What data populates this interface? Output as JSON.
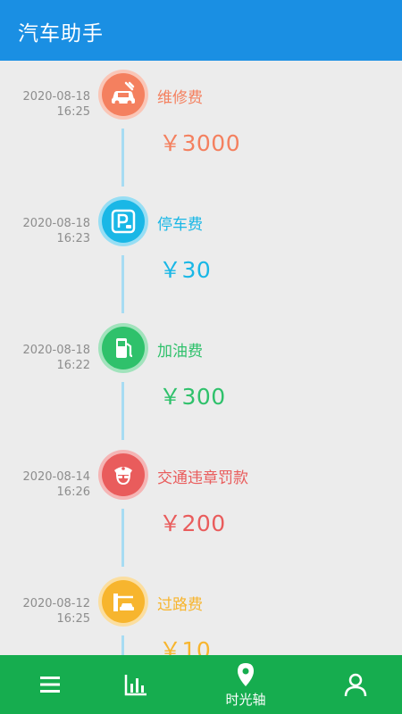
{
  "app": {
    "title": "汽车助手"
  },
  "colors": {
    "appbar": "#1a8fe3",
    "bottom_bar": "#16ad4f",
    "timeline_line": "#a7dcf3",
    "repair": "#f4805f",
    "parking": "#19b7e6",
    "fuel": "#2fc16b",
    "violation": "#e95c5c",
    "toll": "#f7b52e"
  },
  "entries": [
    {
      "date": "2020-08-18",
      "time": "16:25",
      "category": "维修费",
      "amount": "￥3000",
      "icon": "car-repair-icon",
      "color": "#f4805f"
    },
    {
      "date": "2020-08-18",
      "time": "16:23",
      "category": "停车费",
      "amount": "￥30",
      "icon": "parking-icon",
      "color": "#19b7e6"
    },
    {
      "date": "2020-08-18",
      "time": "16:22",
      "category": "加油费",
      "amount": "￥300",
      "icon": "fuel-pump-icon",
      "color": "#2fc16b"
    },
    {
      "date": "2020-08-14",
      "time": "16:26",
      "category": "交通违章罚款",
      "amount": "￥200",
      "icon": "police-icon",
      "color": "#e95c5c"
    },
    {
      "date": "2020-08-12",
      "time": "16:25",
      "category": "过路费",
      "amount": "￥10",
      "icon": "toll-gate-icon",
      "color": "#f7b52e"
    }
  ],
  "bottom_nav": [
    {
      "icon": "menu-icon",
      "label": ""
    },
    {
      "icon": "bar-chart-icon",
      "label": ""
    },
    {
      "icon": "location-pin-icon",
      "label": "时光轴"
    },
    {
      "icon": "user-icon",
      "label": ""
    }
  ]
}
